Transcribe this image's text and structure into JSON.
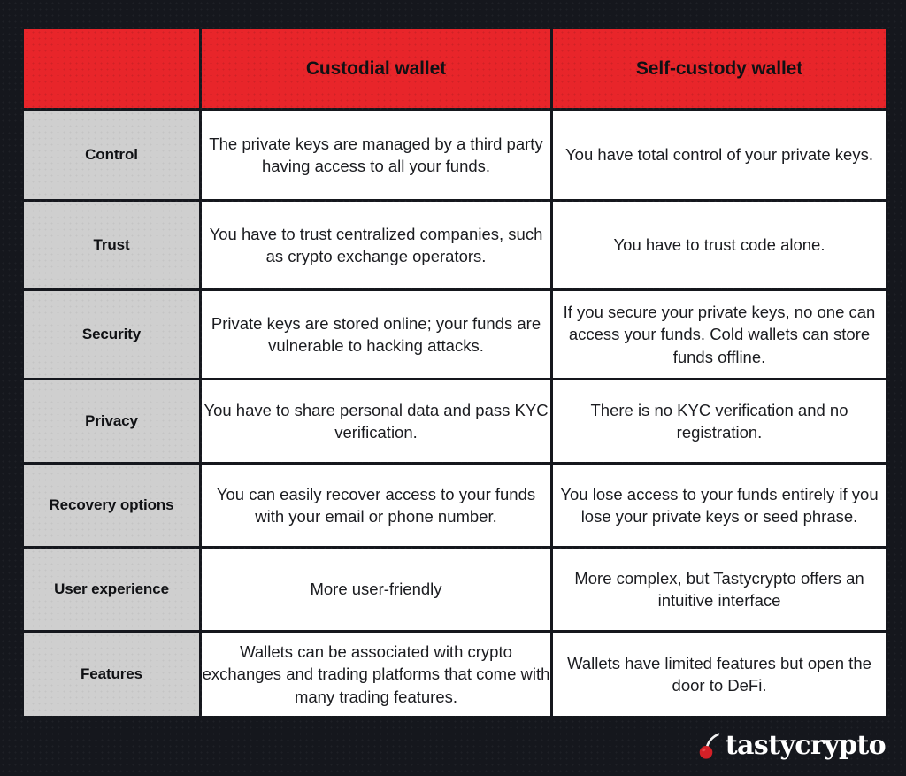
{
  "table": {
    "columns": [
      {
        "key": "label",
        "header": ""
      },
      {
        "key": "custodial",
        "header": "Custodial wallet"
      },
      {
        "key": "self",
        "header": "Self-custody wallet"
      }
    ],
    "header_blank": "",
    "rows": [
      {
        "label": "Control",
        "custodial": "The private keys are managed by a third party having access to all your funds.",
        "self": "You have total control of your private keys."
      },
      {
        "label": "Trust",
        "custodial": "You have to trust centralized companies, such as crypto exchange operators.",
        "self": "You have to trust code alone."
      },
      {
        "label": "Security",
        "custodial": "Private keys are stored online; your funds are vulnerable to hacking attacks.",
        "self": "If you secure your private keys, no one can access your funds. Cold wallets can store funds offline."
      },
      {
        "label": "Privacy",
        "custodial": "You have to share personal data and pass KYC verification.",
        "self": "There is no KYC verification and no registration."
      },
      {
        "label": "Recovery options",
        "custodial": "You can easily recover access to your funds with your email or phone number.",
        "self": "You lose access to your funds entirely if you lose your private keys or seed phrase."
      },
      {
        "label": "User experience",
        "custodial": "More user-friendly",
        "self": "More complex, but Tastycrypto offers an intuitive interface"
      },
      {
        "label": "Features",
        "custodial": "Wallets can be associated with crypto exchanges and trading platforms that come with many trading features.",
        "self": "Wallets have limited features but open the door to DeFi."
      }
    ]
  },
  "logo": {
    "icon": "cherry-icon",
    "text": "tastycrypto"
  },
  "colors": {
    "background": "#15171d",
    "header_red": "#e8252a",
    "label_gray": "#cfcfcf",
    "cell_white": "#ffffff",
    "text_dark": "#101114",
    "logo_text": "#ffffff",
    "cherry_red": "#d42027"
  }
}
